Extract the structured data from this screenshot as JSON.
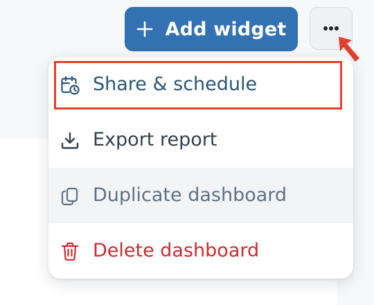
{
  "toolbar": {
    "add_widget_label": "Add widget",
    "add_widget_icon": "plus-icon",
    "more_icon": "ellipsis-icon"
  },
  "menu": {
    "items": [
      {
        "label": "Share & schedule",
        "icon": "calendar-clock-icon",
        "color": "#2a5577",
        "highlighted": true
      },
      {
        "label": "Export report",
        "icon": "download-icon",
        "color": "#33414f"
      },
      {
        "label": "Duplicate dashboard",
        "icon": "copy-icon",
        "color": "#5e7185",
        "hovered": true
      },
      {
        "label": "Delete dashboard",
        "icon": "trash-icon",
        "color": "#cf2a2f"
      }
    ]
  },
  "colors": {
    "accent": "#3271b2",
    "danger": "#cf2a2f",
    "highlight": "#e2402c"
  }
}
